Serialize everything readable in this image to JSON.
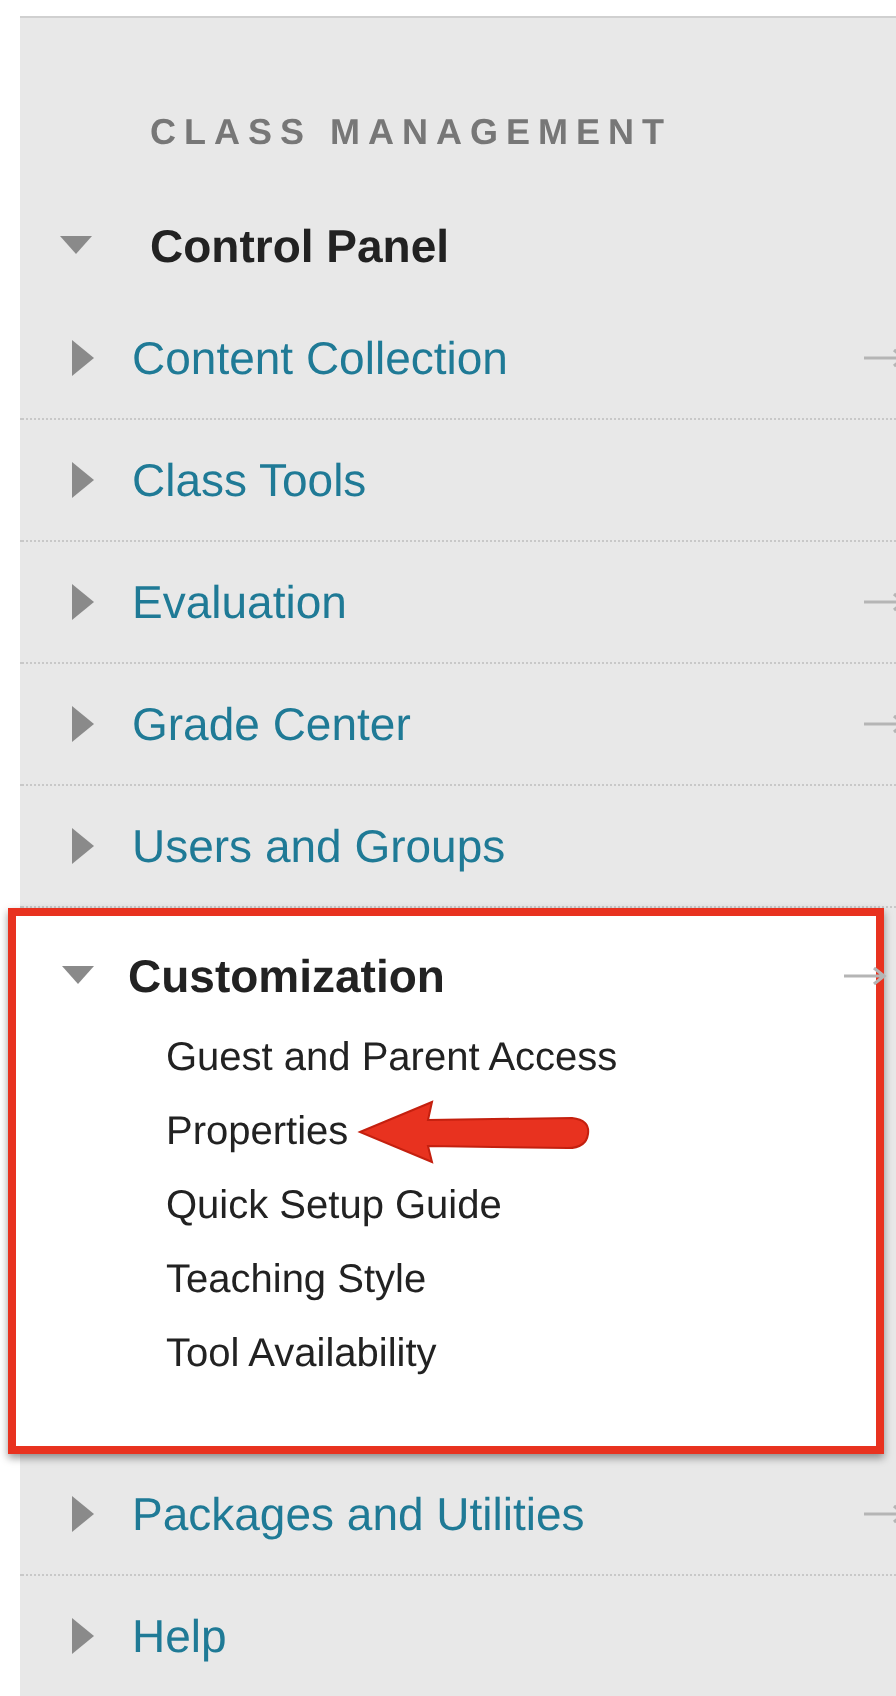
{
  "sidebar": {
    "heading": "CLASS MANAGEMENT",
    "panel": {
      "label": "Control Panel",
      "expanded": true,
      "items": [
        {
          "label": "Content Collection",
          "expanded": false,
          "shortcut": true,
          "highlighted": false
        },
        {
          "label": "Class Tools",
          "expanded": false,
          "shortcut": false,
          "highlighted": false
        },
        {
          "label": "Evaluation",
          "expanded": false,
          "shortcut": true,
          "highlighted": false
        },
        {
          "label": "Grade Center",
          "expanded": false,
          "shortcut": true,
          "highlighted": false
        },
        {
          "label": "Users and Groups",
          "expanded": false,
          "shortcut": false,
          "highlighted": false
        },
        {
          "label": "Customization",
          "expanded": true,
          "shortcut": true,
          "highlighted": true,
          "children": [
            {
              "label": "Guest and Parent Access",
              "callout": false
            },
            {
              "label": "Properties",
              "callout": true
            },
            {
              "label": "Quick Setup Guide",
              "callout": false
            },
            {
              "label": "Teaching Style",
              "callout": false
            },
            {
              "label": "Tool Availability",
              "callout": false
            }
          ]
        },
        {
          "label": "Packages and Utilities",
          "expanded": false,
          "shortcut": true,
          "highlighted": false
        },
        {
          "label": "Help",
          "expanded": false,
          "shortcut": false,
          "highlighted": false
        }
      ]
    }
  }
}
